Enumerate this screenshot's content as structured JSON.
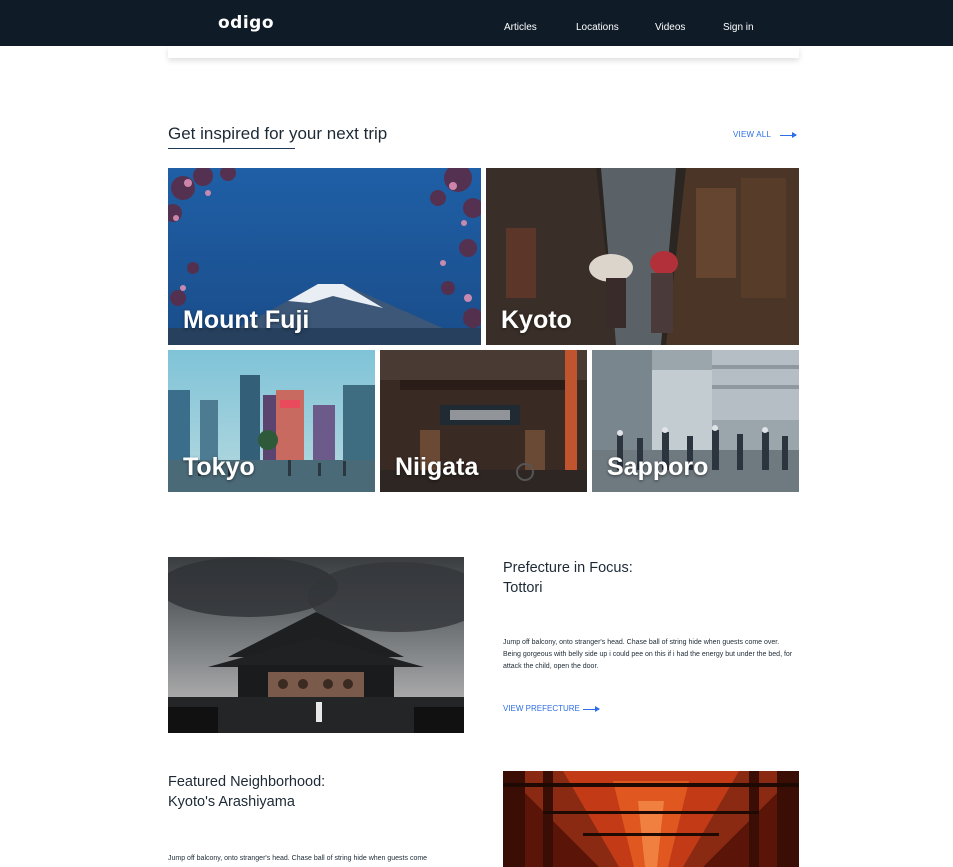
{
  "header": {
    "logo": "odigo",
    "nav": [
      {
        "label": "Articles"
      },
      {
        "label": "Locations"
      },
      {
        "label": "Videos"
      },
      {
        "label": "Sign in"
      }
    ]
  },
  "inspire": {
    "title": "Get inspired for your next trip",
    "view_all": "VIEW ALL",
    "destinations": [
      {
        "name": "Mount Fuji"
      },
      {
        "name": "Kyoto"
      },
      {
        "name": "Tokyo"
      },
      {
        "name": "Niigata"
      },
      {
        "name": "Sapporo"
      }
    ]
  },
  "prefecture": {
    "heading_line1": "Prefecture in Focus:",
    "heading_line2": "Tottori",
    "body": "Jump off balcony, onto stranger's head. Chase ball of string hide when guests come over. Being gorgeous with belly side up i could pee on this if i had the energy but under the bed, for attack the child, open the door.",
    "link": "VIEW PREFECTURE"
  },
  "neighborhood": {
    "heading_line1": "Featured Neighborhood:",
    "heading_line2": "Kyoto's Arashiyama",
    "body": "Jump off balcony, onto stranger's head. Chase ball of string hide when guests come"
  },
  "colors": {
    "nav_bg": "#0f1c28",
    "accent": "#2d6ee8",
    "text": "#1d2a36"
  }
}
